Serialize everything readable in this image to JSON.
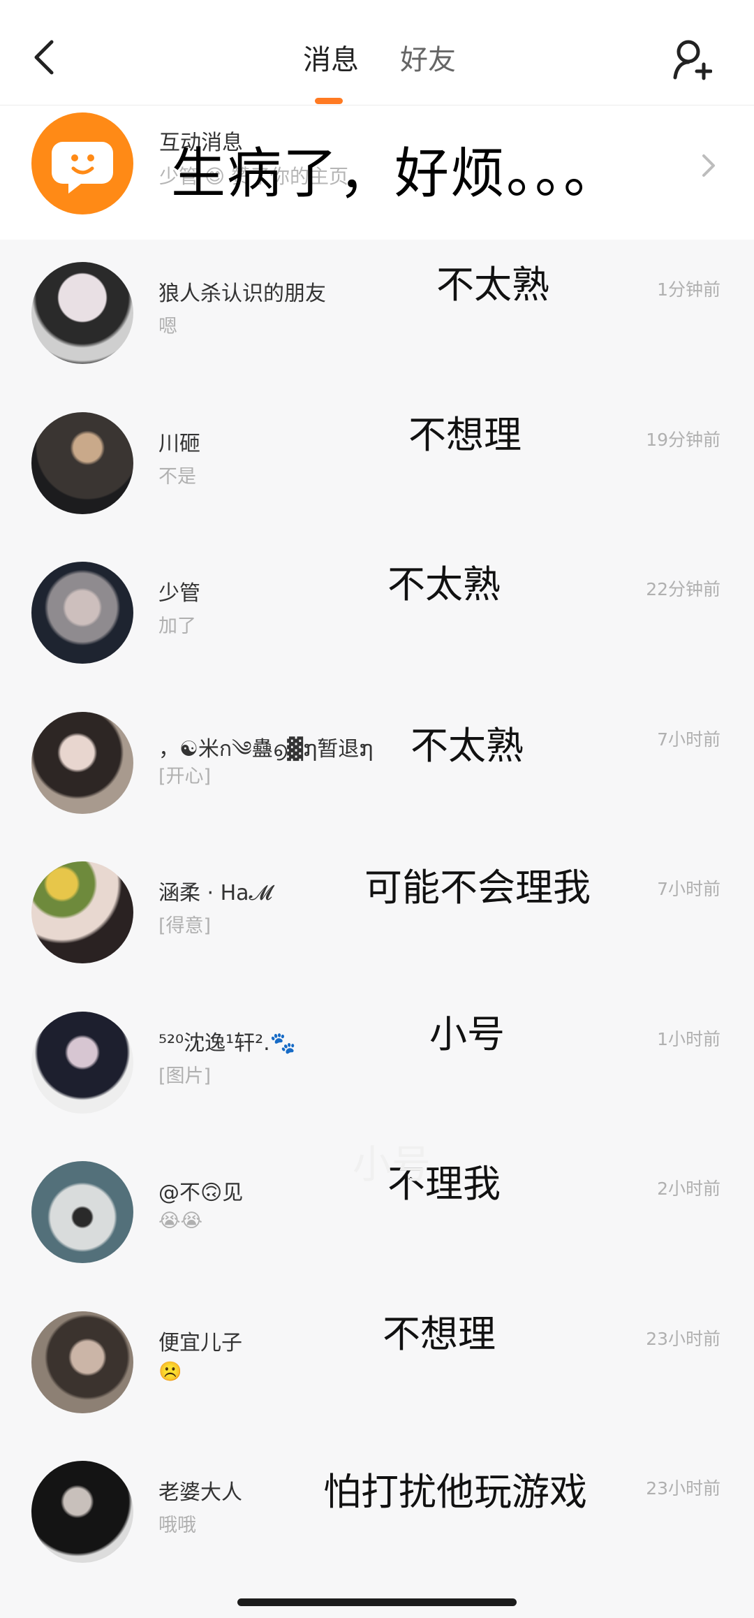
{
  "header": {
    "tabs": [
      {
        "label": "消息",
        "active": true
      },
      {
        "label": "好友",
        "active": false
      }
    ],
    "accent_color": "#ff7a22",
    "back_icon": "chevron-left-icon",
    "add_friend_icon": "add-user-icon"
  },
  "interactive": {
    "title": "互动消息",
    "subtitle": "少管 😊 赞了你的主页",
    "overlay": "生病了，好烦。。。",
    "icon": "chat-bubble-smile-icon"
  },
  "conversations": [
    {
      "name": "狼人杀认识的朋友",
      "preview": "嗯",
      "time": "1分钟前",
      "annotation": "不太熟"
    },
    {
      "name": "川砸",
      "preview": "不是",
      "time": "19分钟前",
      "annotation": "不想理"
    },
    {
      "name": "少管",
      "preview": "加了",
      "time": "22分钟前",
      "annotation": "不太熟"
    },
    {
      "name": "，☯米ก༄蠱൭▓໗暂退໗",
      "preview": "[开心]",
      "time": "7小时前",
      "annotation": "不太熟"
    },
    {
      "name": "涵柔 · Ha𝓜",
      "preview": "[得意]",
      "time": "7小时前",
      "annotation": "可能不会理我"
    },
    {
      "name": "⁵²⁰沈逸¹轩².🐾",
      "preview": "[图片]",
      "time": "1小时前",
      "annotation": "小号"
    },
    {
      "name": "@不🙃见",
      "preview": "😭😭",
      "time": "2小时前",
      "annotation": "不理我"
    },
    {
      "name": "便宜儿子",
      "preview": "☹️",
      "time": "23小时前",
      "annotation": "不想理"
    },
    {
      "name": "老婆大人",
      "preview": "哦哦",
      "time": "23小时前",
      "annotation": "怕打扰他玩游戏"
    }
  ],
  "watermark": "小号"
}
